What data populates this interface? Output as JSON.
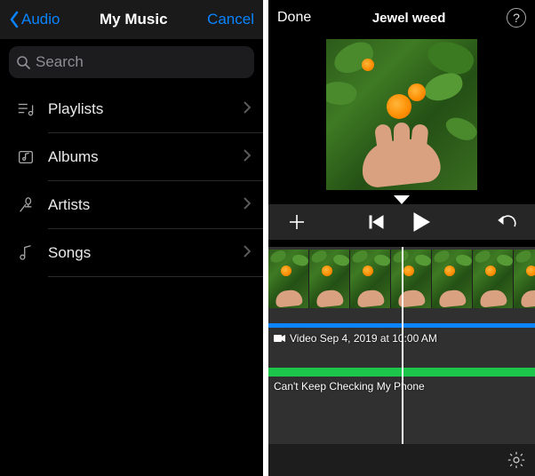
{
  "left": {
    "back_label": "Audio",
    "title": "My Music",
    "cancel_label": "Cancel",
    "search_placeholder": "Search",
    "rows": {
      "playlists": "Playlists",
      "albums": "Albums",
      "artists": "Artists",
      "songs": "Songs"
    }
  },
  "right": {
    "done_label": "Done",
    "title": "Jewel weed",
    "help_label": "?",
    "video_clip_label": "Video Sep 4, 2019 at 10:00 AM",
    "audio_clip_label": "Can't Keep Checking My Phone"
  }
}
